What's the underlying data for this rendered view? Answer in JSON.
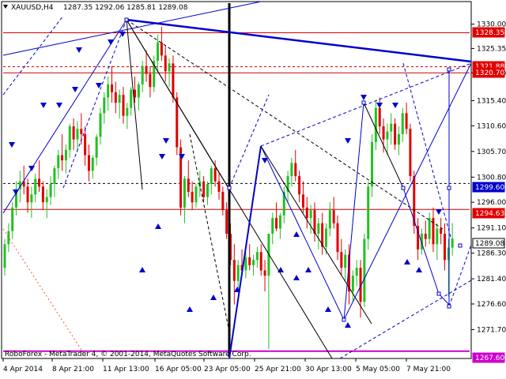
{
  "header": {
    "symbol": "XAUUSD,H4",
    "ohlc": "1287.35 1292.06 1285.81 1289.08"
  },
  "copyright": "RoboForex - MetaTrader 4, © 2001-2014, MetaQuotes Software Corp.",
  "colors": {
    "background": "#ffffff",
    "bull": "#22c122",
    "bear": "#e00000",
    "level_line": "#d00000",
    "trend_line": "#0000cc",
    "black_line": "#000000",
    "badge_red": "#e00000",
    "badge_blue": "#0000cc",
    "badge_current": "#000000",
    "magenta": "#cc00cc",
    "dotted_red": "#e06030"
  },
  "price_axis": {
    "ticks": [
      "1330.00",
      "1325.35",
      "1320.70",
      "1315.40",
      "1310.60",
      "1305.70",
      "1300.80",
      "1296.00",
      "1291.10",
      "1286.30",
      "1281.40",
      "1276.60",
      "1271.70"
    ]
  },
  "time_axis": {
    "ticks": [
      "4 Apr 2014",
      "8 Apr 21:00",
      "11 Apr 13:00",
      "16 Apr 05:00",
      "23 Apr 05:00",
      "25 Apr 21:00",
      "30 Apr 13:00",
      "5 May 05:00",
      "7 May 21:00"
    ]
  },
  "price_badges": [
    {
      "label": "1328.35",
      "kind": "red"
    },
    {
      "label": "1321.88",
      "kind": "red"
    },
    {
      "label": "1320.70",
      "kind": "red"
    },
    {
      "label": "1299.60",
      "kind": "blue"
    },
    {
      "label": "1294.63",
      "kind": "red"
    },
    {
      "label": "1289.08",
      "kind": "current"
    },
    {
      "label": "1267.60",
      "kind": "magenta"
    }
  ],
  "chart_data": {
    "type": "candlestick",
    "symbol": "XAUUSD",
    "timeframe": "H4",
    "y_range": [
      1266.5,
      1334.0
    ],
    "last": {
      "open": 1287.35,
      "high": 1292.06,
      "low": 1285.81,
      "close": 1289.08
    },
    "horizontal_levels": [
      1328.35,
      1321.88,
      1320.7,
      1299.6,
      1294.63,
      1267.6
    ],
    "candles_ohlc": [
      [
        1283.5,
        1289.0,
        1282.0,
        1288.0
      ],
      [
        1288.0,
        1292.0,
        1286.5,
        1290.5
      ],
      [
        1290.5,
        1296.0,
        1289.0,
        1295.0
      ],
      [
        1295.0,
        1300.0,
        1293.5,
        1298.5
      ],
      [
        1298.5,
        1302.0,
        1296.0,
        1300.0
      ],
      [
        1300.0,
        1303.0,
        1297.5,
        1299.0
      ],
      [
        1299.0,
        1300.5,
        1294.0,
        1296.0
      ],
      [
        1296.0,
        1299.0,
        1293.0,
        1297.5
      ],
      [
        1297.5,
        1301.5,
        1296.0,
        1300.5
      ],
      [
        1300.5,
        1304.0,
        1298.0,
        1299.0
      ],
      [
        1299.0,
        1300.0,
        1294.5,
        1296.0
      ],
      [
        1296.0,
        1298.5,
        1293.0,
        1297.0
      ],
      [
        1297.0,
        1301.0,
        1295.5,
        1299.5
      ],
      [
        1299.5,
        1303.0,
        1297.0,
        1302.5
      ],
      [
        1302.5,
        1306.0,
        1300.5,
        1305.0
      ],
      [
        1305.0,
        1309.0,
        1302.0,
        1304.0
      ],
      [
        1304.0,
        1307.0,
        1301.5,
        1306.0
      ],
      [
        1306.0,
        1311.0,
        1304.5,
        1310.5
      ],
      [
        1310.5,
        1312.0,
        1306.0,
        1308.0
      ],
      [
        1308.0,
        1311.5,
        1305.5,
        1310.0
      ],
      [
        1310.0,
        1313.0,
        1307.0,
        1309.0
      ],
      [
        1309.0,
        1310.5,
        1303.0,
        1305.0
      ],
      [
        1305.0,
        1307.0,
        1300.0,
        1302.0
      ],
      [
        1302.0,
        1305.0,
        1300.5,
        1304.5
      ],
      [
        1304.5,
        1309.0,
        1303.0,
        1308.5
      ],
      [
        1308.5,
        1314.0,
        1307.0,
        1313.0
      ],
      [
        1313.0,
        1317.0,
        1311.0,
        1316.0
      ],
      [
        1316.0,
        1320.0,
        1313.5,
        1318.5
      ],
      [
        1318.5,
        1322.0,
        1315.0,
        1317.0
      ],
      [
        1317.0,
        1319.0,
        1313.0,
        1315.0
      ],
      [
        1315.0,
        1317.5,
        1312.0,
        1316.5
      ],
      [
        1316.5,
        1318.0,
        1311.0,
        1312.5
      ],
      [
        1312.5,
        1315.0,
        1310.0,
        1314.0
      ],
      [
        1314.0,
        1318.0,
        1312.5,
        1317.5
      ],
      [
        1317.5,
        1320.0,
        1315.0,
        1316.0
      ],
      [
        1316.0,
        1319.0,
        1313.5,
        1318.5
      ],
      [
        1318.5,
        1323.0,
        1317.0,
        1322.0
      ],
      [
        1322.0,
        1325.0,
        1319.0,
        1320.5
      ],
      [
        1320.5,
        1322.0,
        1316.0,
        1318.0
      ],
      [
        1318.0,
        1324.0,
        1317.0,
        1323.0
      ],
      [
        1323.0,
        1328.0,
        1321.0,
        1326.5
      ],
      [
        1326.5,
        1329.5,
        1323.0,
        1324.0
      ],
      [
        1324.0,
        1326.0,
        1319.0,
        1321.0
      ],
      [
        1321.0,
        1323.5,
        1318.0,
        1322.5
      ],
      [
        1322.5,
        1324.0,
        1315.0,
        1316.0
      ],
      [
        1316.0,
        1317.0,
        1305.0,
        1306.5
      ],
      [
        1306.5,
        1308.0,
        1293.5,
        1295.0
      ],
      [
        1295.0,
        1301.0,
        1292.0,
        1300.5
      ],
      [
        1300.5,
        1304.0,
        1297.0,
        1298.0
      ],
      [
        1298.0,
        1300.0,
        1294.5,
        1296.0
      ],
      [
        1296.0,
        1299.5,
        1295.0,
        1299.0
      ],
      [
        1299.0,
        1302.0,
        1297.0,
        1300.0
      ],
      [
        1300.0,
        1301.0,
        1296.0,
        1297.0
      ],
      [
        1297.0,
        1300.0,
        1295.5,
        1299.5
      ],
      [
        1299.5,
        1303.0,
        1297.5,
        1302.5
      ],
      [
        1302.5,
        1304.0,
        1299.0,
        1300.0
      ],
      [
        1300.0,
        1301.5,
        1296.5,
        1298.0
      ],
      [
        1298.0,
        1299.0,
        1293.5,
        1294.5
      ],
      [
        1294.5,
        1296.0,
        1289.0,
        1290.0
      ],
      [
        1290.0,
        1292.0,
        1284.0,
        1285.0
      ],
      [
        1285.0,
        1288.0,
        1276.5,
        1281.0
      ],
      [
        1281.0,
        1285.0,
        1279.5,
        1284.0
      ],
      [
        1284.0,
        1287.0,
        1282.0,
        1283.0
      ],
      [
        1283.0,
        1286.5,
        1281.5,
        1285.5
      ],
      [
        1285.5,
        1288.0,
        1283.0,
        1284.0
      ],
      [
        1284.0,
        1286.0,
        1282.0,
        1285.0
      ],
      [
        1285.0,
        1287.5,
        1283.5,
        1286.5
      ],
      [
        1286.5,
        1288.0,
        1282.0,
        1283.0
      ],
      [
        1283.0,
        1285.0,
        1279.0,
        1282.0
      ],
      [
        1282.0,
        1284.5,
        1268.0,
        1290.0
      ],
      [
        1290.0,
        1294.0,
        1288.0,
        1293.0
      ],
      [
        1293.0,
        1296.0,
        1290.5,
        1291.0
      ],
      [
        1291.0,
        1294.0,
        1289.0,
        1293.5
      ],
      [
        1293.5,
        1299.0,
        1292.0,
        1298.0
      ],
      [
        1298.0,
        1302.0,
        1296.0,
        1301.0
      ],
      [
        1301.0,
        1304.5,
        1299.0,
        1303.5
      ],
      [
        1303.5,
        1306.0,
        1300.0,
        1301.0
      ],
      [
        1301.0,
        1302.0,
        1296.0,
        1297.5
      ],
      [
        1297.5,
        1300.0,
        1294.0,
        1295.0
      ],
      [
        1295.0,
        1297.0,
        1291.0,
        1293.0
      ],
      [
        1293.0,
        1295.5,
        1290.0,
        1294.5
      ],
      [
        1294.5,
        1296.0,
        1288.5,
        1290.0
      ],
      [
        1290.0,
        1293.0,
        1287.0,
        1292.0
      ],
      [
        1292.0,
        1294.0,
        1286.0,
        1287.5
      ],
      [
        1287.5,
        1292.0,
        1286.0,
        1291.0
      ],
      [
        1291.0,
        1296.0,
        1289.5,
        1294.5
      ],
      [
        1294.5,
        1297.0,
        1291.0,
        1292.0
      ],
      [
        1292.0,
        1293.5,
        1285.0,
        1286.5
      ],
      [
        1286.5,
        1289.0,
        1282.0,
        1283.5
      ],
      [
        1283.5,
        1287.0,
        1281.0,
        1286.0
      ],
      [
        1286.0,
        1288.0,
        1276.5,
        1279.0
      ],
      [
        1279.0,
        1283.0,
        1277.0,
        1282.0
      ],
      [
        1282.0,
        1285.0,
        1280.0,
        1283.5
      ],
      [
        1283.5,
        1285.0,
        1274.0,
        1277.0
      ],
      [
        1277.0,
        1290.0,
        1276.0,
        1289.0
      ],
      [
        1289.0,
        1300.0,
        1287.0,
        1299.0
      ],
      [
        1299.0,
        1309.0,
        1297.0,
        1307.5
      ],
      [
        1307.5,
        1315.5,
        1306.0,
        1314.0
      ],
      [
        1314.0,
        1316.0,
        1309.0,
        1310.5
      ],
      [
        1310.5,
        1312.0,
        1305.5,
        1308.0
      ],
      [
        1308.0,
        1311.0,
        1305.0,
        1309.5
      ],
      [
        1309.5,
        1313.0,
        1307.0,
        1311.0
      ],
      [
        1311.0,
        1312.0,
        1306.0,
        1307.0
      ],
      [
        1307.0,
        1310.5,
        1305.0,
        1309.0
      ],
      [
        1309.0,
        1314.0,
        1307.5,
        1313.0
      ],
      [
        1313.0,
        1315.0,
        1309.0,
        1310.0
      ],
      [
        1310.0,
        1311.0,
        1300.0,
        1301.0
      ],
      [
        1301.0,
        1302.0,
        1290.0,
        1291.5
      ],
      [
        1291.5,
        1293.0,
        1285.0,
        1287.0
      ],
      [
        1287.0,
        1291.0,
        1286.0,
        1290.0
      ],
      [
        1290.0,
        1292.5,
        1287.5,
        1289.0
      ],
      [
        1289.0,
        1294.0,
        1288.0,
        1293.0
      ],
      [
        1293.0,
        1295.0,
        1286.5,
        1288.0
      ],
      [
        1288.0,
        1292.0,
        1285.0,
        1291.0
      ],
      [
        1291.0,
        1293.0,
        1288.0,
        1290.0
      ],
      [
        1290.0,
        1292.0,
        1283.0,
        1285.0
      ],
      [
        1285.0,
        1289.0,
        1278.0,
        1287.35
      ],
      [
        1287.35,
        1292.06,
        1285.81,
        1289.08
      ]
    ]
  }
}
